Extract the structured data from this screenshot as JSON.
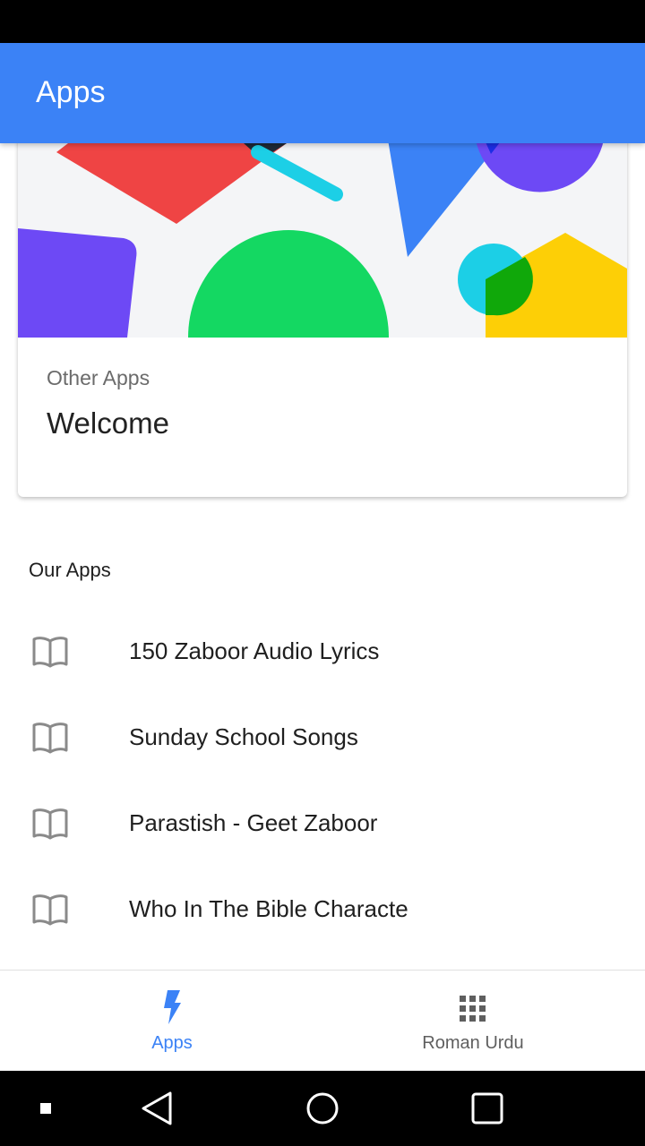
{
  "app_bar": {
    "title": "Apps",
    "color": "#3b82f6"
  },
  "card": {
    "subtitle": "Other Apps",
    "title": "Welcome"
  },
  "section": {
    "header": "Our Apps"
  },
  "apps": [
    {
      "label": "150 Zaboor Audio Lyrics",
      "icon": "book-open-icon"
    },
    {
      "label": "Sunday School Songs",
      "icon": "book-open-icon"
    },
    {
      "label": "Parastish - Geet Zaboor",
      "icon": "book-open-icon"
    },
    {
      "label": "Who In The Bible Characte",
      "icon": "book-open-icon"
    }
  ],
  "bottom_nav": {
    "items": [
      {
        "label": "Apps",
        "icon": "bolt-icon",
        "active": true
      },
      {
        "label": "Roman Urdu",
        "icon": "grid-icon",
        "active": false
      }
    ],
    "active_color": "#3b82f6"
  },
  "system_nav": {
    "buttons": [
      "recents-small-icon",
      "back-icon",
      "home-icon",
      "overview-icon"
    ]
  }
}
